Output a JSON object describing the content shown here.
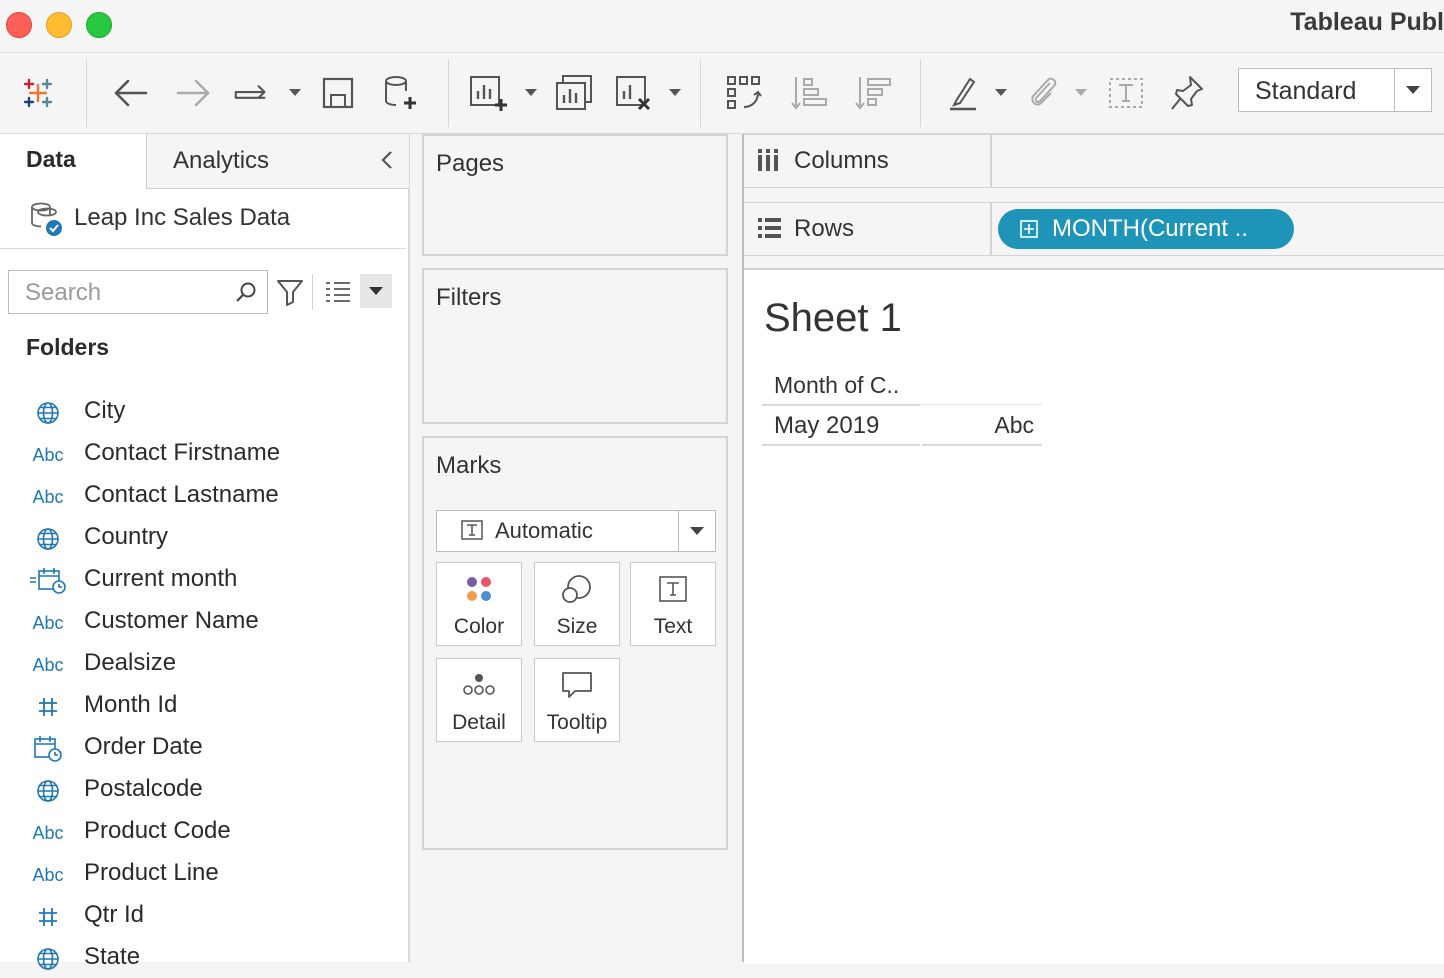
{
  "window": {
    "title": "Tableau Publ"
  },
  "toolbar": {
    "mark_type_select": "Standard"
  },
  "data_pane": {
    "tabs": {
      "data": "Data",
      "analytics": "Analytics"
    },
    "datasource": "Leap Inc Sales Data",
    "search": {
      "placeholder": "Search",
      "value": ""
    },
    "folders_title": "Folders",
    "fields": [
      {
        "type": "geo",
        "icon": "globe-icon",
        "name": "City"
      },
      {
        "type": "string",
        "icon": "abc-icon",
        "abc": "Abc",
        "name": "Contact Firstname"
      },
      {
        "type": "string",
        "icon": "abc-icon",
        "abc": "Abc",
        "name": "Contact Lastname"
      },
      {
        "type": "geo",
        "icon": "globe-icon",
        "name": "Country"
      },
      {
        "type": "calc-date",
        "icon": "calc-date-icon",
        "name": "Current month"
      },
      {
        "type": "string",
        "icon": "abc-icon",
        "abc": "Abc",
        "name": "Customer Name"
      },
      {
        "type": "string",
        "icon": "abc-icon",
        "abc": "Abc",
        "name": "Dealsize"
      },
      {
        "type": "number",
        "icon": "hash-icon",
        "name": "Month Id"
      },
      {
        "type": "date",
        "icon": "date-icon",
        "name": "Order Date"
      },
      {
        "type": "geo",
        "icon": "globe-icon",
        "name": "Postalcode"
      },
      {
        "type": "string",
        "icon": "abc-icon",
        "abc": "Abc",
        "name": "Product Code"
      },
      {
        "type": "string",
        "icon": "abc-icon",
        "abc": "Abc",
        "name": "Product Line"
      },
      {
        "type": "number",
        "icon": "hash-icon",
        "name": "Qtr Id"
      },
      {
        "type": "geo",
        "icon": "globe-icon",
        "name": "State"
      }
    ]
  },
  "cards": {
    "pages": "Pages",
    "filters": "Filters",
    "marks": {
      "title": "Marks",
      "type": "Automatic",
      "buttons": {
        "color": "Color",
        "size": "Size",
        "text": "Text",
        "detail": "Detail",
        "tooltip": "Tooltip"
      }
    }
  },
  "shelves": {
    "columns": "Columns",
    "rows": "Rows",
    "rows_pill": "MONTH(Current .."
  },
  "view": {
    "sheet_title": "Sheet 1",
    "header": "Month of C..",
    "row_label": "May 2019",
    "row_value": "Abc"
  },
  "colors": {
    "pill": "#1e95b8",
    "field_icon": "#1f77b4"
  }
}
